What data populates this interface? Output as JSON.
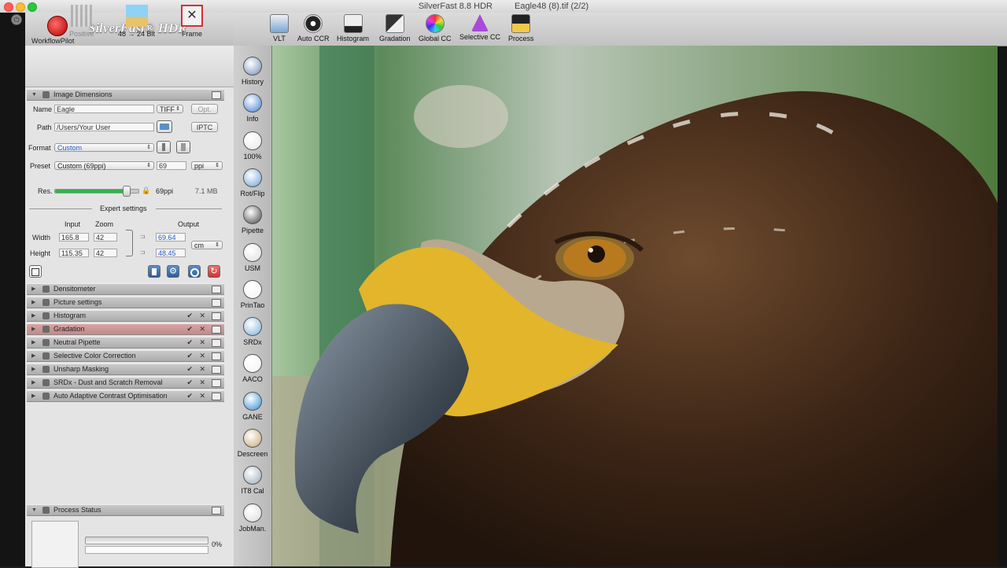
{
  "window": {
    "app_title": "SilverFast 8.8 HDR",
    "file_title": "Eagle48 (8).tif (2/2)"
  },
  "brand": {
    "workflow_label": "WorkflowPilot",
    "logo_text": "SilverFast® HDR"
  },
  "toolbar": {
    "items": [
      {
        "label": "VLT",
        "icon": "vlt-icon"
      },
      {
        "label": "Auto CCR",
        "icon": "auto-ccr-icon"
      },
      {
        "label": "Histogram",
        "icon": "histogram-icon"
      },
      {
        "label": "Gradation",
        "icon": "gradation-icon"
      },
      {
        "label": "Global CC",
        "icon": "global-cc-icon"
      },
      {
        "label": "Selective CC",
        "icon": "selective-cc-icon"
      },
      {
        "label": "Process",
        "icon": "process-icon"
      }
    ]
  },
  "modes": {
    "positive": "Positive",
    "bitdepth": "48 → 24 Bit",
    "frame": "Frame"
  },
  "image_dimensions": {
    "header": "Image Dimensions",
    "name_label": "Name",
    "name_value": "Eagle",
    "format_select": "TIFF",
    "opt_button": "Opt.",
    "path_label": "Path",
    "path_value": "/Users/Your User",
    "iptc_button": "IPTC",
    "format_label": "Format",
    "format_value": "Custom",
    "preset_label": "Preset",
    "preset_value": "Custom (69ppi)",
    "preset_number": "69",
    "preset_unit": "ppi",
    "res_label": "Res.",
    "res_value": "69ppi",
    "res_fraction": 0.86,
    "file_size": "7.1 MB",
    "expert_settings": "Expert settings",
    "input_label": "Input",
    "zoom_label": "Zoom",
    "output_label": "Output",
    "width_label": "Width",
    "width_input": "165.8",
    "width_zoom": "42",
    "width_output": "69.64",
    "height_label": "Height",
    "height_input": "115.35",
    "height_zoom": "42",
    "height_output": "48.45",
    "unit": "cm"
  },
  "tool_sections": [
    {
      "label": "Densitometer",
      "checks": false,
      "highlight": false
    },
    {
      "label": "Picture settings",
      "checks": false,
      "highlight": false
    },
    {
      "label": "Histogram",
      "checks": true,
      "highlight": false
    },
    {
      "label": "Gradation",
      "checks": true,
      "highlight": true
    },
    {
      "label": "Neutral Pipette",
      "checks": true,
      "highlight": false
    },
    {
      "label": "Selective Color Correction",
      "checks": true,
      "highlight": false
    },
    {
      "label": "Unsharp Masking",
      "checks": true,
      "highlight": false
    },
    {
      "label": "SRDx - Dust and Scratch Removal",
      "checks": true,
      "highlight": false
    },
    {
      "label": "Auto Adaptive Contrast Optimisation",
      "checks": true,
      "highlight": false
    }
  ],
  "process_status": {
    "header": "Process Status",
    "percent": "0%"
  },
  "tools": [
    {
      "label": "History",
      "icon": "history-icon"
    },
    {
      "label": "Info",
      "icon": "info-icon"
    },
    {
      "label": "100%",
      "icon": "zoom-icon"
    },
    {
      "label": "Rot/Flip",
      "icon": "rotate-flip-icon"
    },
    {
      "label": "Pipette",
      "icon": "pipette-icon"
    },
    {
      "label": "USM",
      "icon": "usm-icon"
    },
    {
      "label": "PrinTao",
      "icon": "printao-icon"
    },
    {
      "label": "SRDx",
      "icon": "srdx-icon"
    },
    {
      "label": "AACO",
      "icon": "aaco-icon"
    },
    {
      "label": "GANE",
      "icon": "gane-icon"
    },
    {
      "label": "Descreen",
      "icon": "descreen-icon"
    },
    {
      "label": "IT8 Cal",
      "icon": "it8-cal-icon"
    },
    {
      "label": "JobMan.",
      "icon": "jobman-icon"
    }
  ]
}
